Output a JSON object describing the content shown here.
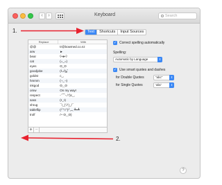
{
  "window": {
    "title": "Keyboard",
    "search_placeholder": "Search"
  },
  "tabs": [
    {
      "label": "Text",
      "active": true
    },
    {
      "label": "Shortcuts",
      "active": false
    },
    {
      "label": "Input Sources",
      "active": false
    }
  ],
  "table": {
    "headers": {
      "replace": "Replace",
      "with": "With"
    },
    "rows": [
      {
        "replace": "@@",
        "with": "tr@bowmed.co.nz"
      },
      {
        "replace": "arw",
        "with": "►"
      },
      {
        "replace": "bear",
        "with": "ʕ•ᴥ•ʔ"
      },
      {
        "replace": "cat",
        "with": "(=_=)"
      },
      {
        "replace": "eyes",
        "with": "ʘ_ʘ"
      },
      {
        "replace": "goodjobe",
        "with": "(•̀ᴗ•́)و ̑̑"
      },
      {
        "replace": "goldst",
        "with": "c_,"
      },
      {
        "replace": "hmmm",
        "with": "(¬_¬)"
      },
      {
        "replace": "inkgod",
        "with": "ʘ‿ʘ"
      },
      {
        "replace": "omw",
        "with": "On my way!"
      },
      {
        "replace": "respect",
        "with": "-`⌒-./ ̄/)c_,"
      },
      {
        "replace": "sass",
        "with": "(•_•)"
      },
      {
        "replace": "shrug",
        "with": "¯\\_(ツ)_/¯"
      },
      {
        "replace": "tableflip",
        "with": "(╯°□°)╯︵ ┻━┻"
      },
      {
        "replace": "trolf",
        "with": "/~ ʘ‿ʘ)"
      }
    ],
    "add_label": "+",
    "remove_label": "−"
  },
  "settings": {
    "correct_spelling": {
      "label": "Correct spelling automatically",
      "checked": true
    },
    "spelling_label": "Spelling:",
    "spelling_value": "Automatic by Language",
    "smart_quotes": {
      "label": "Use smart quotes and dashes",
      "checked": true
    },
    "double_quotes_label": "for Double Quotes",
    "double_quotes_value": "“abc”",
    "single_quotes_label": "for Single Quotes",
    "single_quotes_value": "‘abc’"
  },
  "help_label": "?",
  "annotations": {
    "callout_1": "1.",
    "callout_2": "2.",
    "arrow_color": "#e8212e"
  },
  "colors": {
    "accent": "#3b88f5",
    "close": "#fc605c",
    "minimize": "#fdbc40",
    "zoom": "#34c84a"
  }
}
